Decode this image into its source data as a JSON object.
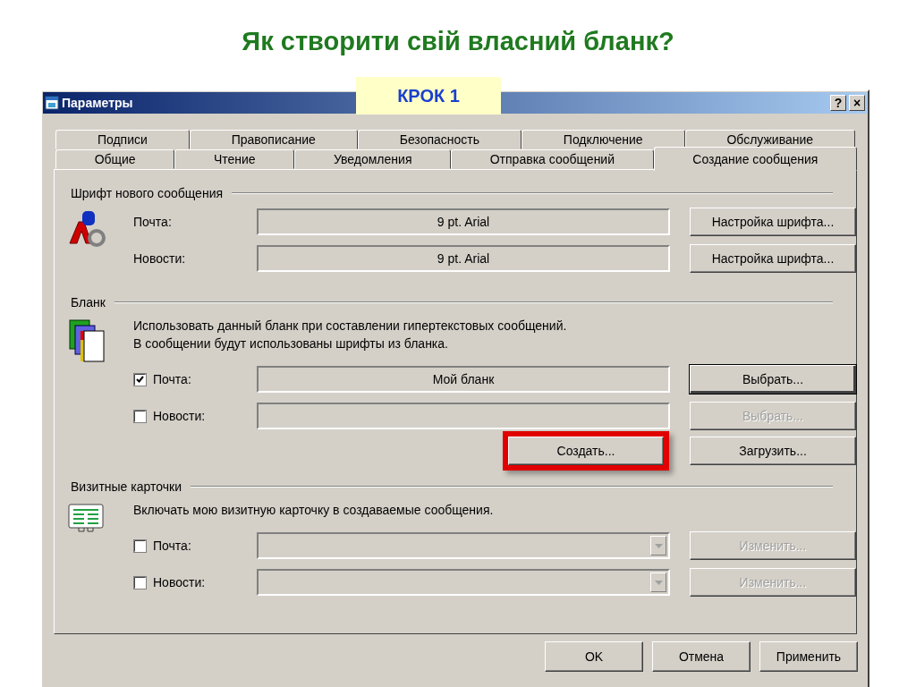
{
  "slide_title": "Як створити свій власний бланк?",
  "step_label": "КРОК 1",
  "window": {
    "title": "Параметры",
    "help": "?",
    "close": "×"
  },
  "tab_rows": [
    {
      "tabs": [
        {
          "label": "Подписи",
          "selected": false
        },
        {
          "label": "Правописание",
          "selected": false
        },
        {
          "label": "Безопасность",
          "selected": false
        },
        {
          "label": "Подключение",
          "selected": false
        },
        {
          "label": "Обслуживание",
          "selected": false
        }
      ]
    },
    {
      "tabs": [
        {
          "label": "Общие",
          "selected": false
        },
        {
          "label": "Чтение",
          "selected": false
        },
        {
          "label": "Уведомления",
          "selected": false
        },
        {
          "label": "Отправка сообщений",
          "selected": false
        },
        {
          "label": "Создание сообщения",
          "selected": true
        }
      ]
    }
  ],
  "sections": [
    {
      "title": "Шрифт нового сообщения",
      "kind": "font",
      "rows": [
        {
          "label": "Почта:",
          "kind": "text",
          "value": "9 pt. Arial",
          "button": {
            "label": "Настройка шрифта...",
            "disabled": false,
            "default": false
          }
        },
        {
          "label": "Новости:",
          "kind": "text",
          "value": "9 pt. Arial",
          "button": {
            "label": "Настройка шрифта...",
            "disabled": false,
            "default": false
          }
        }
      ]
    },
    {
      "title": "Бланк",
      "kind": "stationery",
      "description": [
        "Использовать данный бланк при составлении гипертекстовых сообщений.",
        "В сообщении будут использованы шрифты из бланка."
      ],
      "rows": [
        {
          "label": "Почта:",
          "checked": true,
          "kind": "text",
          "value": "Мой бланк",
          "button": {
            "label": "Выбрать...",
            "disabled": false,
            "default": true
          }
        },
        {
          "label": "Новости:",
          "checked": false,
          "kind": "text",
          "button": {
            "label": "Выбрать...",
            "disabled": true,
            "default": false
          }
        }
      ],
      "extra_buttons": [
        {
          "label": "Создать...",
          "highlighted": true
        },
        {
          "label": "Загрузить...",
          "highlighted": false
        }
      ]
    },
    {
      "title": "Визитные карточки",
      "kind": "card",
      "description": [
        "Включать мою визитную карточку в создаваемые сообщения."
      ],
      "rows": [
        {
          "label": "Почта:",
          "checked": false,
          "kind": "dropdown",
          "button": {
            "label": "Изменить...",
            "disabled": true,
            "default": false
          }
        },
        {
          "label": "Новости:",
          "checked": false,
          "kind": "dropdown",
          "button": {
            "label": "Изменить...",
            "disabled": true,
            "default": false
          }
        }
      ]
    }
  ],
  "footer_buttons": [
    "OK",
    "Отмена",
    "Применить"
  ]
}
